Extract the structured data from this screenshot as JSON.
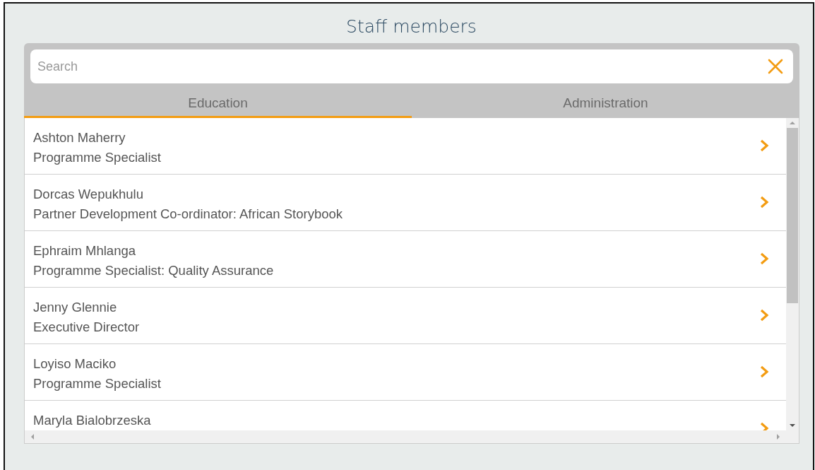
{
  "title": "Staff members",
  "search": {
    "placeholder": "Search"
  },
  "tabs": [
    {
      "label": "Education",
      "selected": true
    },
    {
      "label": "Administration",
      "selected": false
    }
  ],
  "staff": [
    {
      "name": "Ashton Maherry",
      "role": "Programme Specialist"
    },
    {
      "name": "Dorcas Wepukhulu",
      "role": "Partner Development Co-ordinator: African Storybook"
    },
    {
      "name": "Ephraim Mhlanga",
      "role": "Programme Specialist: Quality Assurance"
    },
    {
      "name": "Jenny Glennie",
      "role": "Executive Director"
    },
    {
      "name": "Loyiso Maciko",
      "role": "Programme Specialist"
    },
    {
      "name": "Maryla Bialobrzeska"
    }
  ]
}
